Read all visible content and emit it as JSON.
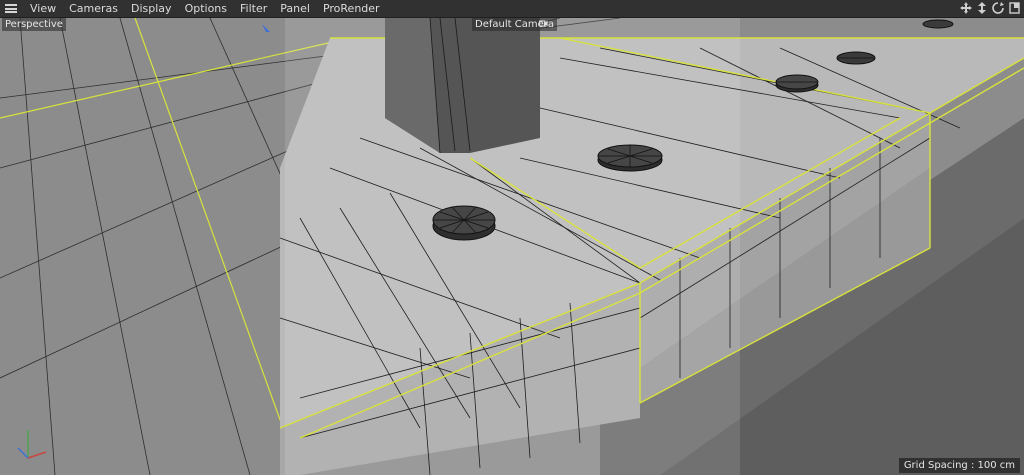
{
  "menu": {
    "items": [
      "View",
      "Cameras",
      "Display",
      "Options",
      "Filter",
      "Panel",
      "ProRender"
    ]
  },
  "nav_icons": [
    "move-view-icon",
    "zoom-view-icon",
    "rotate-view-icon",
    "toggle-view-icon"
  ],
  "viewport": {
    "view_label": "Perspective",
    "camera_label": "Default Camera",
    "grid_spacing": "Grid Spacing : 100 cm"
  },
  "colors": {
    "selection_edge": "#d8e23c",
    "wire": "#1a1a1a",
    "surface": "#b9b9b9",
    "floor": "#8e8e8e"
  }
}
